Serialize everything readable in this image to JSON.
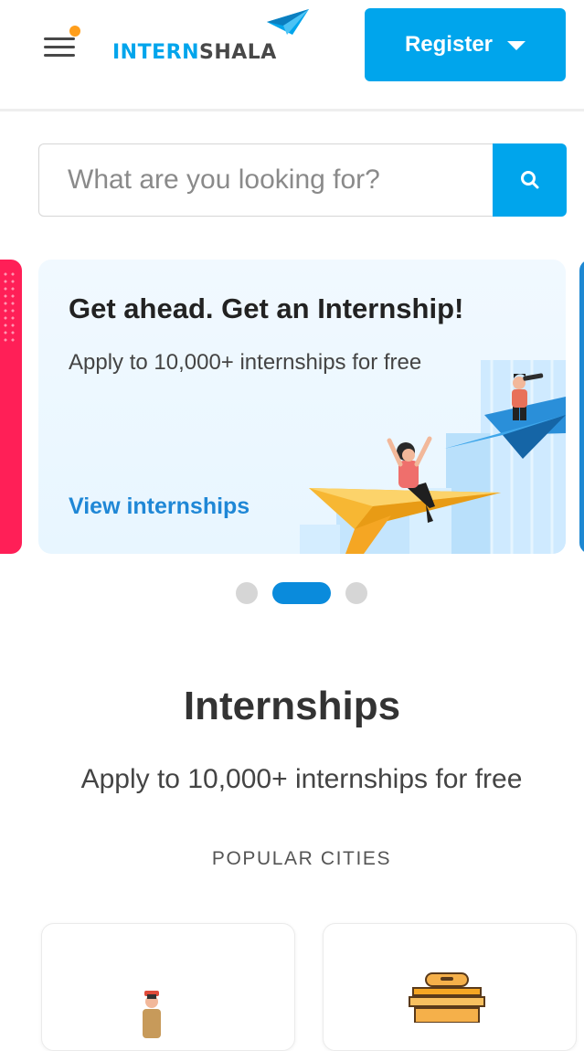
{
  "header": {
    "logo_part_a": "INTERN",
    "logo_part_b": "SHALA",
    "register_label": "Register"
  },
  "search": {
    "placeholder": "What are you looking for?"
  },
  "carousel": {
    "title": "Get ahead. Get an Internship!",
    "subtitle": "Apply to 10,000+ internships for free",
    "link": "View internships",
    "active_index": 1,
    "slide_count": 3
  },
  "internships": {
    "title": "Internships",
    "subtitle": "Apply to 10,000+ internships for free",
    "popular_cities_label": "POPULAR CITIES"
  },
  "colors": {
    "brand_blue": "#00a5ec",
    "brand_dark": "#484848",
    "link_blue": "#1f87d6",
    "notification_dot": "#ff9e1b"
  },
  "icons": {
    "menu": "hamburger-icon",
    "search": "search-icon",
    "dropdown": "caret-down-icon"
  }
}
